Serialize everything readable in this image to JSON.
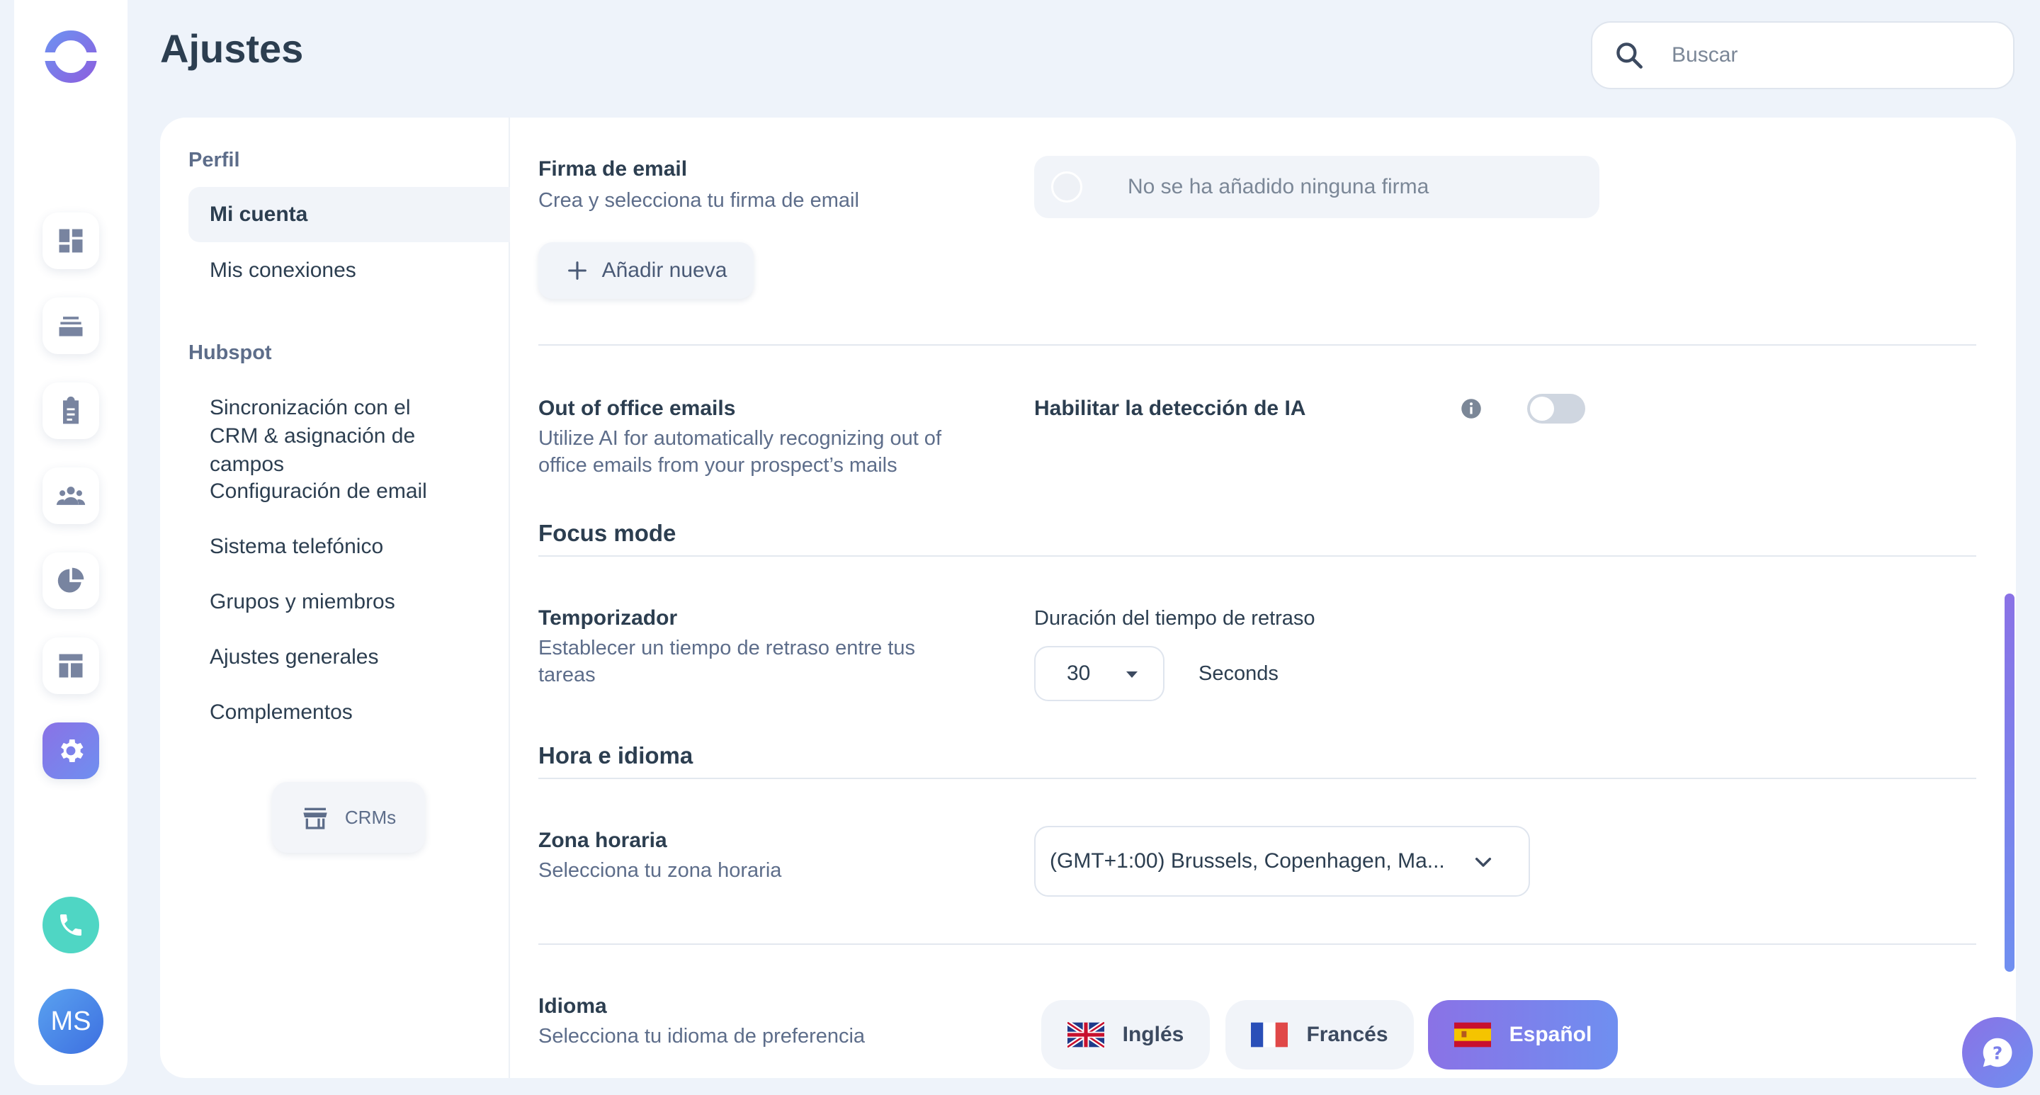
{
  "app": {
    "title": "Ajustes"
  },
  "search": {
    "placeholder": "Buscar"
  },
  "rail": {
    "icons": [
      "dashboard-icon",
      "inbox-icon",
      "tasks-icon",
      "contacts-icon",
      "reports-icon",
      "templates-icon",
      "settings-icon"
    ],
    "avatar_initials": "MS"
  },
  "nav": {
    "section_profile": "Perfil",
    "item_account": "Mi cuenta",
    "item_connections": "Mis conexiones",
    "section_hubspot": "Hubspot",
    "item_crm_sync": "Sincronización con el CRM & asignación de campos",
    "item_email_config": "Configuración de email",
    "item_phone": "Sistema telefónico",
    "item_groups": "Grupos y miembros",
    "item_general": "Ajustes generales",
    "item_addons": "Complementos",
    "crms_button": "CRMs"
  },
  "signature": {
    "title": "Firma de email",
    "description": "Crea y selecciona tu firma de email",
    "empty_text": "No se ha añadido ninguna firma",
    "add_button": "Añadir nueva"
  },
  "ooo": {
    "title": "Out of office emails",
    "description": "Utilize AI for automatically recognizing out of office emails from your prospect’s mails",
    "toggle_label": "Habilitar la detección de IA",
    "toggle_on": false
  },
  "focus": {
    "heading": "Focus mode",
    "timer_title": "Temporizador",
    "timer_description": "Establecer un tiempo de retraso entre tus tareas",
    "delay_label": "Duración del tiempo de retraso",
    "delay_value": "30",
    "delay_unit": "Seconds"
  },
  "time_lang": {
    "heading": "Hora e idioma",
    "tz_title": "Zona horaria",
    "tz_description": "Selecciona tu zona horaria",
    "tz_value": "(GMT+1:00) Brussels, Copenhagen, Ma...",
    "lang_title": "Idioma",
    "lang_description": "Selecciona tu idioma de preferencia",
    "languages": [
      {
        "label": "Inglés",
        "selected": false
      },
      {
        "label": "Francés",
        "selected": false
      },
      {
        "label": "Español",
        "selected": true
      }
    ]
  },
  "colors": {
    "accent": "#7b7fea",
    "teal": "#4fd6c4",
    "text": "#2c3e50",
    "muted": "#5d6d8a"
  }
}
